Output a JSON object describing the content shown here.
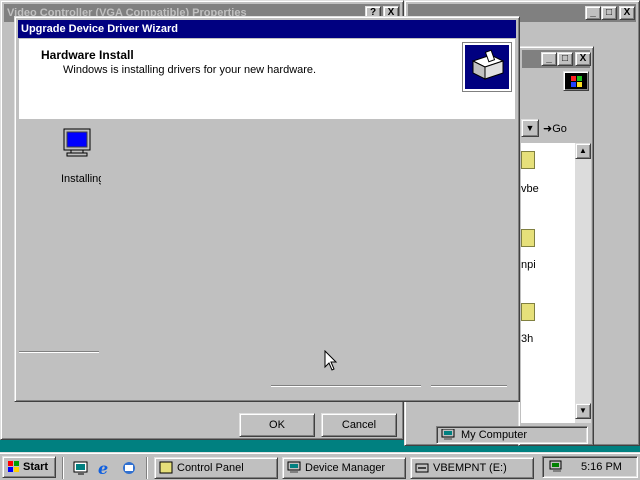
{
  "properties_window": {
    "title": "Video Controller (VGA Compatible) Properties",
    "help_btn": "?",
    "close_btn": "X",
    "ok_label": "OK",
    "cancel_label": "Cancel"
  },
  "explorer_window": {
    "min_btn": "_",
    "max_btn": "□",
    "close_btn": "X",
    "go_label": "Go",
    "statusbar_label": "My Computer",
    "items": [
      {
        "label": "vbe"
      },
      {
        "label": "npi"
      },
      {
        "label": "3h"
      }
    ]
  },
  "wizard": {
    "title": "Upgrade Device Driver Wizard",
    "header_title": "Hardware Install",
    "header_subtitle": "Windows is installing drivers for your new hardware.",
    "status_text": "Installing"
  },
  "taskbar": {
    "start_label": "Start",
    "tasks": [
      {
        "label": "Control Panel"
      },
      {
        "label": "Device Manager"
      },
      {
        "label": "VBEMPNT (E:)"
      }
    ],
    "clock": "5:16 PM"
  }
}
